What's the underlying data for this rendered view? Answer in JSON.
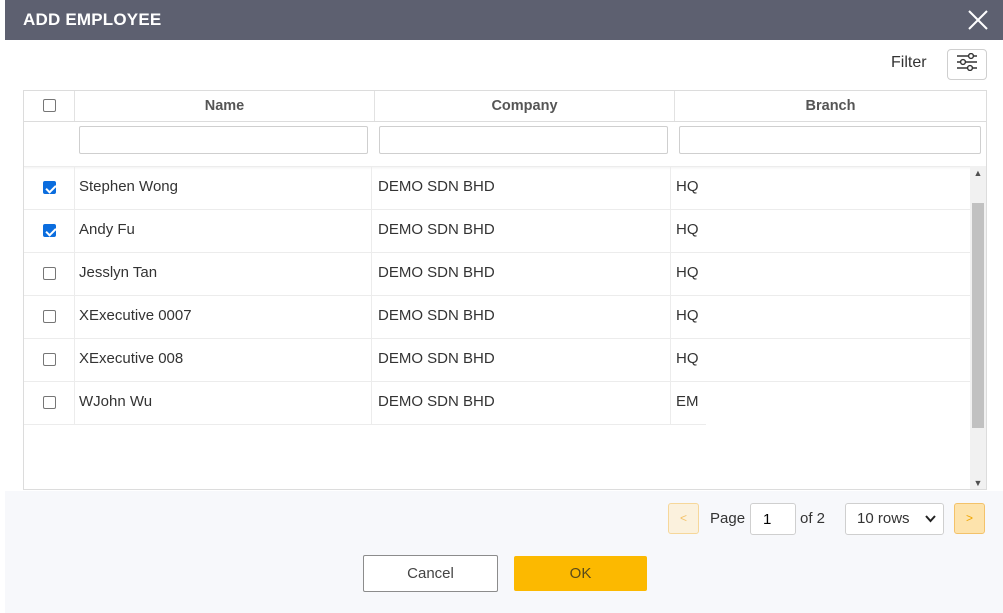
{
  "dialog": {
    "title": "ADD EMPLOYEE"
  },
  "toolbar": {
    "filter_label": "Filter",
    "filter_icon": "sliders-icon"
  },
  "table": {
    "columns": [
      "Name",
      "Company",
      "Branch"
    ],
    "header_checked": false,
    "filters": {
      "name": "",
      "company": "",
      "branch": ""
    },
    "rows": [
      {
        "checked": true,
        "name": "Stephen Wong",
        "company": "DEMO SDN BHD",
        "branch": "HQ"
      },
      {
        "checked": true,
        "name": "Andy Fu",
        "company": "DEMO SDN BHD",
        "branch": "HQ"
      },
      {
        "checked": false,
        "name": "Jesslyn Tan",
        "company": "DEMO SDN BHD",
        "branch": "HQ"
      },
      {
        "checked": false,
        "name": "XExecutive 0007",
        "company": "DEMO SDN BHD",
        "branch": "HQ"
      },
      {
        "checked": false,
        "name": "XExecutive 008",
        "company": "DEMO SDN BHD",
        "branch": "HQ"
      },
      {
        "checked": false,
        "name": "WJohn Wu",
        "company": "DEMO SDN BHD",
        "branch": "EM"
      }
    ]
  },
  "pagination": {
    "prev": "<",
    "page_label": "Page",
    "page_value": "1",
    "of_label": "of 2",
    "rows_option": "10 rows",
    "next": ">"
  },
  "actions": {
    "cancel": "Cancel",
    "ok": "OK"
  },
  "colors": {
    "titlebar": "#5d6070",
    "accent": "#fcb900",
    "checkbox": "#0b6dde"
  }
}
